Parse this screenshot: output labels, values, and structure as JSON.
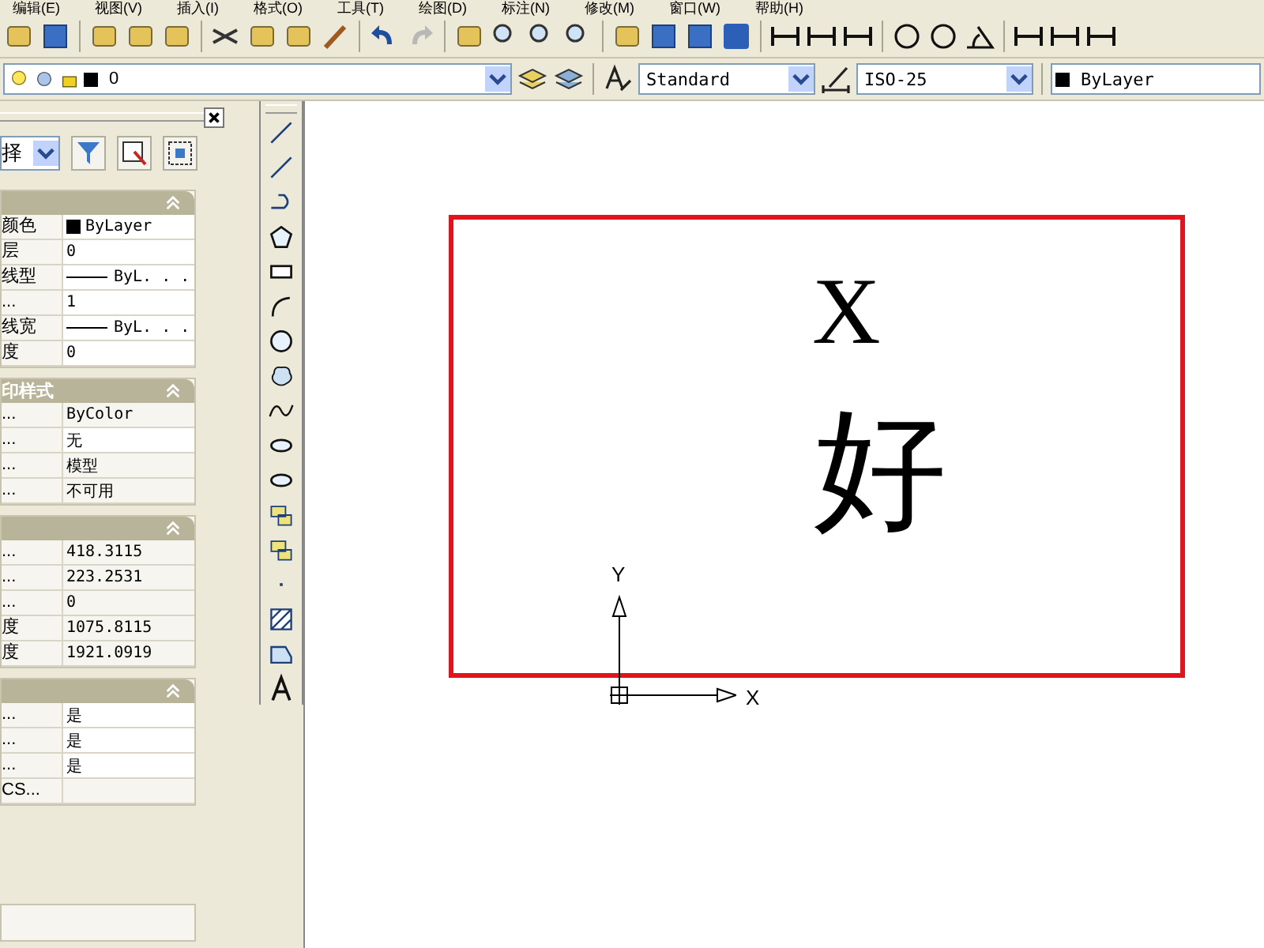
{
  "menu": [
    "编辑(E)",
    "视图(V)",
    "插入(I)",
    "格式(O)",
    "工具(T)",
    "绘图(D)",
    "标注(N)",
    "修改(M)",
    "窗口(W)",
    "帮助(H)"
  ],
  "layer_combo": {
    "value": "0"
  },
  "text_style": {
    "value": "Standard"
  },
  "dim_style": {
    "value": "ISO-25"
  },
  "color_combo": {
    "value": "ByLayer"
  },
  "properties": {
    "select": {
      "value": "择"
    },
    "sections": [
      {
        "rows": [
          {
            "label": "颜色",
            "value": "ByLayer",
            "kind": "color",
            "editable": true
          },
          {
            "label": "层",
            "value": "0",
            "kind": "text",
            "editable": true
          },
          {
            "label": "线型",
            "value": "ByL. . .",
            "kind": "linetype",
            "editable": true
          },
          {
            "label": "...",
            "value": "1",
            "kind": "text",
            "editable": true
          },
          {
            "label": "线宽",
            "value": "ByL. . .",
            "kind": "linetype",
            "editable": true
          },
          {
            "label": "度",
            "value": "0",
            "kind": "text",
            "editable": true
          }
        ]
      },
      {
        "title": "印样式",
        "rows": [
          {
            "label": "...",
            "value": "ByColor",
            "kind": "text",
            "editable": false
          },
          {
            "label": "...",
            "value": "无",
            "kind": "text",
            "editable": true
          },
          {
            "label": "...",
            "value": "模型",
            "kind": "text",
            "editable": false
          },
          {
            "label": "...",
            "value": "不可用",
            "kind": "text",
            "editable": false
          }
        ]
      },
      {
        "rows": [
          {
            "label": "...",
            "value": "418.3115",
            "kind": "text",
            "editable": false
          },
          {
            "label": "...",
            "value": "223.2531",
            "kind": "text",
            "editable": false
          },
          {
            "label": "...",
            "value": "0",
            "kind": "text",
            "editable": false
          },
          {
            "label": "度",
            "value": "1075.8115",
            "kind": "text",
            "editable": false
          },
          {
            "label": "度",
            "value": "1921.0919",
            "kind": "text",
            "editable": false
          }
        ]
      },
      {
        "rows": [
          {
            "label": "...",
            "value": "是",
            "kind": "text",
            "editable": true
          },
          {
            "label": "...",
            "value": "是",
            "kind": "text",
            "editable": true
          },
          {
            "label": "...",
            "value": "是",
            "kind": "text",
            "editable": true
          },
          {
            "label": "CS...",
            "editable": false
          }
        ]
      }
    ]
  },
  "drawing": {
    "texts": [
      "X",
      "好"
    ],
    "ucs": {
      "x_label": "X",
      "y_label": "Y"
    }
  }
}
